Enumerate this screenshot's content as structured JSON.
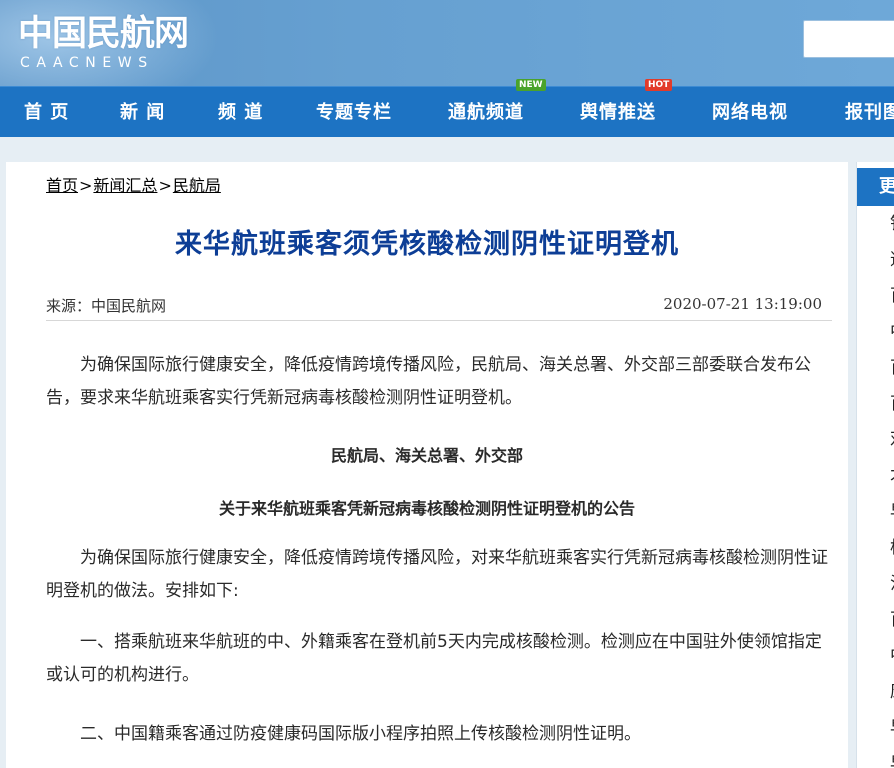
{
  "header": {
    "logo_cn": "中国民航网",
    "logo_en": "CAACNEWS",
    "search_placeholder": ""
  },
  "nav": {
    "items": [
      {
        "label": "首 页"
      },
      {
        "label": "新 闻"
      },
      {
        "label": "频 道"
      },
      {
        "label": "专题专栏"
      },
      {
        "label": "通航频道",
        "badge": "NEW"
      },
      {
        "label": "舆情推送",
        "badge": "HOT"
      },
      {
        "label": "网络电视"
      },
      {
        "label": "报刊图"
      }
    ]
  },
  "breadcrumb": {
    "items": [
      "首页",
      "新闻汇总",
      "民航局"
    ],
    "separator": ">"
  },
  "article": {
    "title": "来华航班乘客须凭核酸检测阴性证明登机",
    "source": "来源：中国民航网",
    "date": "2020-07-21 13:19:00",
    "intro": "为确保国际旅行健康安全，降低疫情跨境传播风险，民航局、海关总署、外交部三部委联合发布公告，要求来华航班乘客实行凭新冠病毒核酸检测阴性证明登机。",
    "issuers": "民航局、海关总署、外交部",
    "notice_title": "关于来华航班乘客凭新冠病毒核酸检测阴性证明登机的公告",
    "p1": "为确保国际旅行健康安全，降低疫情跨境传播风险，对来华航班乘客实行凭新冠病毒核酸检测阴性证明登机的做法。安排如下:",
    "p2": "一、搭乘航班来华航班的中、外籍乘客在登机前5天内完成核酸检测。检测应在中国驻外使领馆指定或认可的机构进行。",
    "p3": "二、中国籍乘客通过防疫健康码国际版小程序拍照上传核酸检测阴性证明。"
  },
  "sidebar": {
    "tab_label": "更",
    "items": [
      "铁",
      "逆",
      "百",
      "中",
      "百",
      "百",
      "邓",
      "才",
      "早",
      "枪",
      "沾",
      "百",
      "中",
      "康",
      "早",
      "早"
    ]
  },
  "colors": {
    "header_bg": "#66a0d1",
    "nav_bg": "#1d73c3",
    "title_color": "#0d3e96",
    "badge_new": "#4aa32b",
    "badge_hot": "#e23a2a"
  }
}
